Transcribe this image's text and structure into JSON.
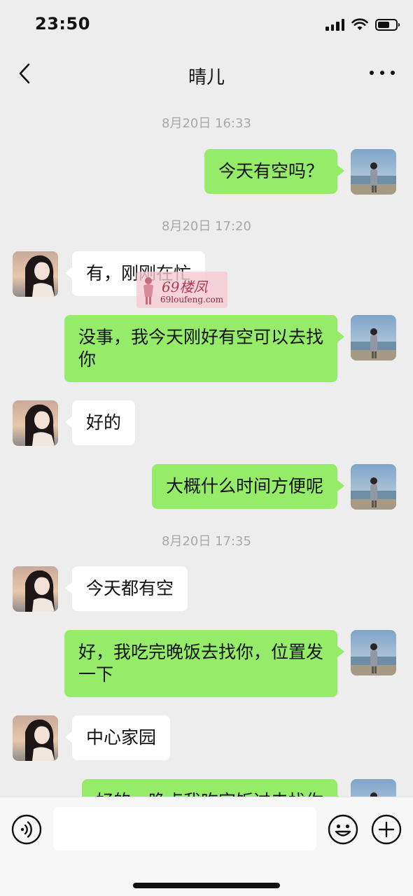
{
  "status_bar": {
    "time": "23:50",
    "battery_level": 0.65
  },
  "header": {
    "title": "晴儿",
    "back_icon": "chevron-left-icon",
    "more_icon": "more-dots-icon"
  },
  "watermark": {
    "brand": "69楼凤",
    "url": "69loufeng.com"
  },
  "messages": [
    {
      "type": "time",
      "text": "8月20日 16:33"
    },
    {
      "type": "self",
      "text": "今天有空吗？"
    },
    {
      "type": "time",
      "text": "8月20日 17:20"
    },
    {
      "type": "other",
      "text": "有，刚刚在忙"
    },
    {
      "type": "self",
      "text": "没事，我今天刚好有空可以去找你"
    },
    {
      "type": "other",
      "text": "好的"
    },
    {
      "type": "self",
      "text": "大概什么时间方便呢"
    },
    {
      "type": "time",
      "text": "8月20日 17:35"
    },
    {
      "type": "other",
      "text": "今天都有空"
    },
    {
      "type": "self",
      "text": "好，我吃完晚饭去找你，位置发一下"
    },
    {
      "type": "other",
      "text": "中心家园"
    },
    {
      "type": "self",
      "text": "好的，晚点我吃完饭过去找你"
    }
  ],
  "colors": {
    "self_bubble": "#95ec69",
    "other_bubble": "#ffffff",
    "background": "#ededed",
    "timestamp": "#a8a8a8"
  },
  "input_bar": {
    "voice_icon": "voice-icon",
    "emoji_icon": "emoji-icon",
    "plus_icon": "plus-icon",
    "value": ""
  }
}
